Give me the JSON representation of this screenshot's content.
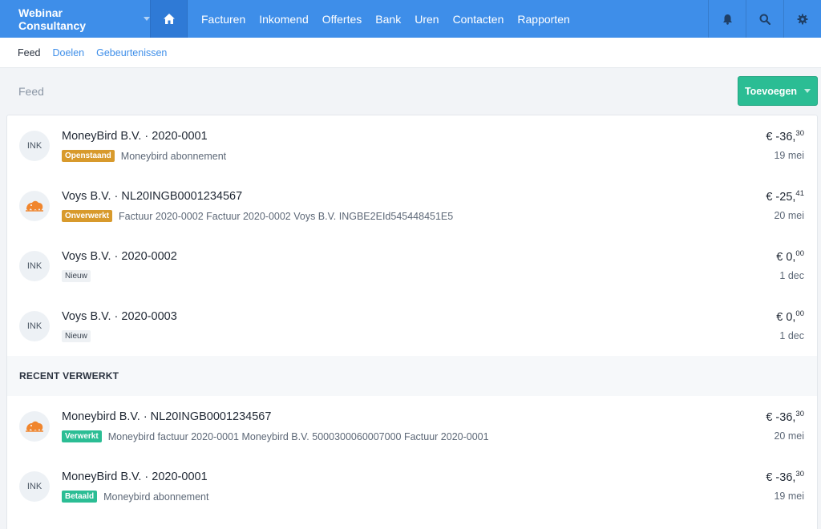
{
  "topbar": {
    "company": "Webinar Consultancy",
    "nav": [
      "Facturen",
      "Inkomend",
      "Offertes",
      "Bank",
      "Uren",
      "Contacten",
      "Rapporten"
    ]
  },
  "subnav": [
    "Feed",
    "Doelen",
    "Gebeurtenissen"
  ],
  "page": {
    "title": "Feed",
    "add_button": "Toevoegen"
  },
  "feed": [
    {
      "avatar": "INK",
      "title": "MoneyBird B.V. · 2020-0001",
      "badge": "Openstaand",
      "badge_color": "orange",
      "desc": "Moneybird abonnement",
      "amount_main": "€ -36,",
      "amount_cents": "30",
      "date": "19 mei"
    },
    {
      "avatar": "lion-logo",
      "title": "Voys B.V. · NL20INGB0001234567",
      "badge": "Onverwerkt",
      "badge_color": "orange",
      "desc": "Factuur 2020-0002 Factuur 2020-0002 Voys B.V. INGBE2EId545448451E5",
      "amount_main": "€ -25,",
      "amount_cents": "41",
      "date": "20 mei"
    },
    {
      "avatar": "INK",
      "title": "Voys B.V. · 2020-0002",
      "badge": "Nieuw",
      "badge_color": "grey",
      "desc": "",
      "amount_main": "€ 0,",
      "amount_cents": "00",
      "date": "1 dec"
    },
    {
      "avatar": "INK",
      "title": "Voys B.V. · 2020-0003",
      "badge": "Nieuw",
      "badge_color": "grey",
      "desc": "",
      "amount_main": "€ 0,",
      "amount_cents": "00",
      "date": "1 dec"
    }
  ],
  "recent": {
    "heading": "RECENT VERWERKT",
    "items": [
      {
        "avatar": "lion-logo",
        "title": "Moneybird B.V. · NL20INGB0001234567",
        "badge": "Verwerkt",
        "badge_color": "green",
        "desc": "Moneybird factuur 2020-0001 Moneybird B.V. 5000300060007000 Factuur 2020-0001",
        "amount_main": "€ -36,",
        "amount_cents": "30",
        "date": "20 mei"
      },
      {
        "avatar": "INK",
        "title": "MoneyBird B.V. · 2020-0001",
        "badge": "Betaald",
        "badge_color": "green",
        "desc": "Moneybird abonnement",
        "amount_main": "€ -36,",
        "amount_cents": "30",
        "date": "19 mei"
      }
    ]
  },
  "colors": {
    "primary": "#3e8ee9",
    "accent_green": "#2bbd94",
    "badge_orange": "#d89a2c"
  },
  "icons": [
    "home-icon",
    "bell-icon",
    "search-icon",
    "gear-icon",
    "lion-logo"
  ]
}
